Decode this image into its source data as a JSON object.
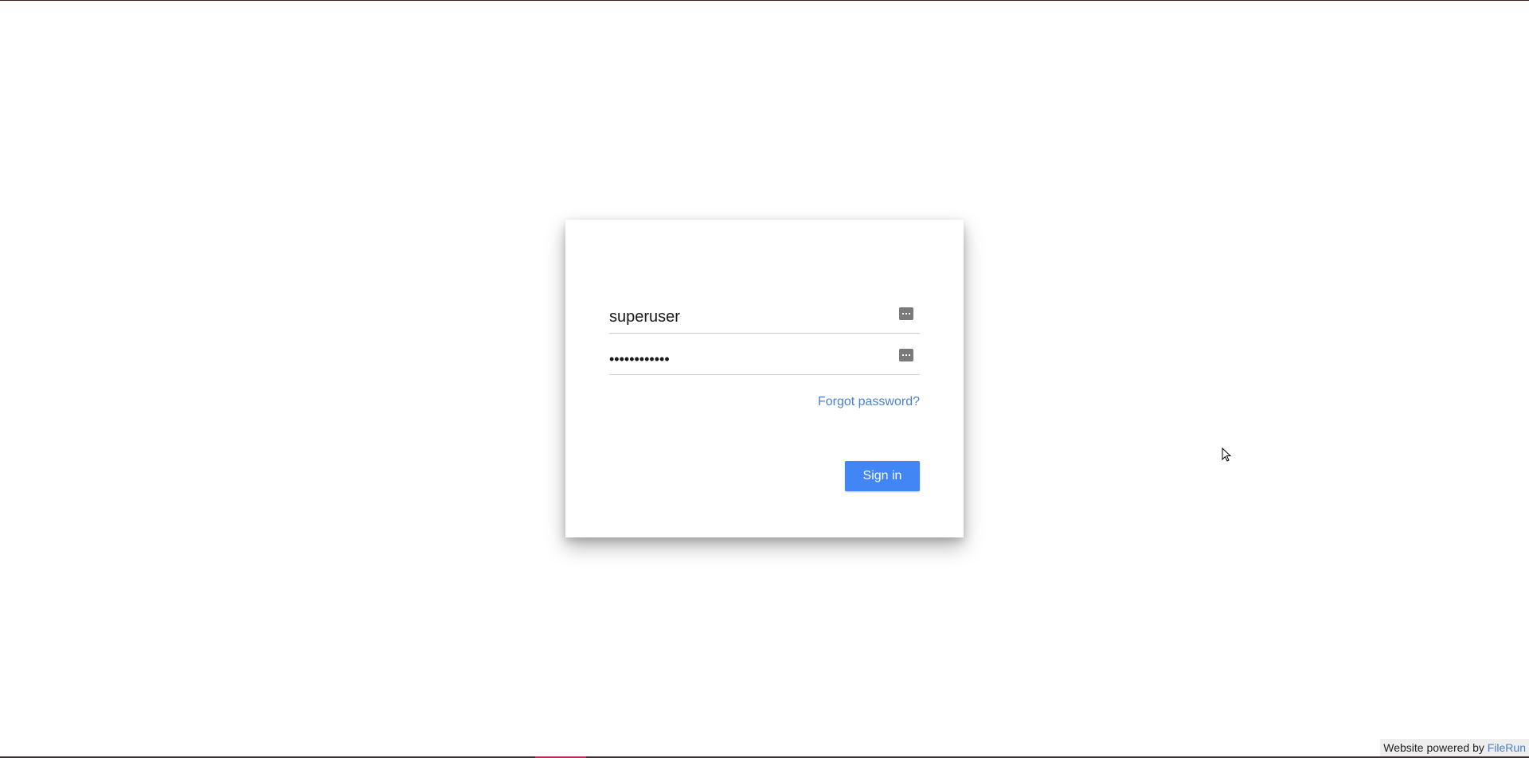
{
  "login": {
    "username_value": "superuser",
    "password_value": "••••••••••••",
    "forgot_password_label": "Forgot password?",
    "sign_in_label": "Sign in"
  },
  "footer": {
    "powered_by_text": "Website powered by",
    "powered_by_link": "FileRun"
  },
  "icons": {
    "field_icon": "key-icon",
    "cursor": "mouse-pointer-icon"
  },
  "colors": {
    "accent": "#4285f4",
    "link": "#4a7fd6",
    "background": "#ffffff"
  }
}
